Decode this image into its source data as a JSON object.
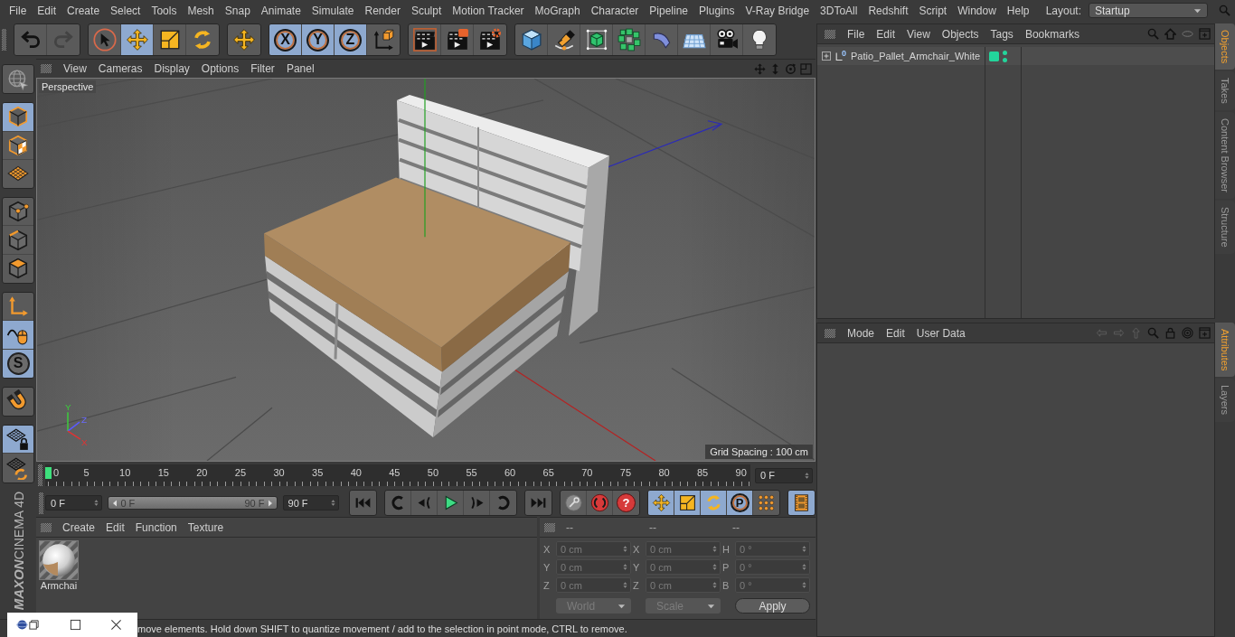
{
  "menu_bar": {
    "items": [
      "File",
      "Edit",
      "Create",
      "Select",
      "Tools",
      "Mesh",
      "Snap",
      "Animate",
      "Simulate",
      "Render",
      "Sculpt",
      "Motion Tracker",
      "MoGraph",
      "Character",
      "Pipeline",
      "Plugins",
      "V-Ray Bridge",
      "3DToAll",
      "Redshift",
      "Script",
      "Window",
      "Help"
    ],
    "layout_label": "Layout:",
    "layout_value": "Startup"
  },
  "toolbar": {
    "groups": [
      {
        "buttons": [
          {
            "kind": "undo",
            "selected": false,
            "disabled": false
          },
          {
            "kind": "redo",
            "selected": false,
            "disabled": true
          }
        ]
      },
      {
        "buttons": [
          {
            "kind": "select",
            "selected": false
          },
          {
            "kind": "move",
            "selected": true
          },
          {
            "kind": "scale",
            "selected": false
          },
          {
            "kind": "rotate",
            "selected": false
          }
        ]
      },
      {
        "buttons": [
          {
            "kind": "move",
            "selected": false
          }
        ]
      },
      {
        "buttons": [
          {
            "kind": "letter",
            "label": "X",
            "selected": true
          },
          {
            "kind": "letter",
            "label": "Y",
            "selected": true
          },
          {
            "kind": "letter",
            "label": "Z",
            "selected": true
          },
          {
            "kind": "coord-system",
            "selected": false
          }
        ]
      },
      {
        "buttons": [
          {
            "kind": "render-view",
            "selected": false
          },
          {
            "kind": "render-picture",
            "selected": false
          },
          {
            "kind": "render-settings",
            "selected": false
          }
        ]
      },
      {
        "buttons": [
          {
            "kind": "cube",
            "selected": false
          },
          {
            "kind": "pen",
            "selected": false
          },
          {
            "kind": "subdivision",
            "selected": false
          },
          {
            "kind": "cloner",
            "selected": false
          },
          {
            "kind": "deformer",
            "selected": false
          },
          {
            "kind": "floor",
            "selected": false
          },
          {
            "kind": "camera",
            "selected": false
          },
          {
            "kind": "light",
            "selected": false
          }
        ]
      }
    ]
  },
  "left_toolbar": {
    "groups": [
      {
        "buttons": [
          {
            "kind": "globe",
            "selected": false
          }
        ]
      },
      {
        "buttons": [
          {
            "kind": "model",
            "selected": true
          },
          {
            "kind": "texture",
            "selected": false
          },
          {
            "kind": "workplane",
            "selected": false
          }
        ]
      },
      {
        "buttons": [
          {
            "kind": "points",
            "selected": false
          },
          {
            "kind": "edges",
            "selected": false
          },
          {
            "kind": "polygons",
            "selected": false
          }
        ]
      },
      {
        "buttons": [
          {
            "kind": "axis",
            "selected": false
          },
          {
            "kind": "tweak",
            "selected": true
          },
          {
            "kind": "solo",
            "label": "S",
            "selected": true
          }
        ]
      },
      {
        "buttons": [
          {
            "kind": "magnet",
            "selected": false
          }
        ]
      },
      {
        "buttons": [
          {
            "kind": "grid-lock",
            "selected": true
          },
          {
            "kind": "grid-rotate",
            "selected": false
          }
        ]
      }
    ],
    "logo": {
      "brand": "MAXON",
      "product": "CINEMA 4D"
    }
  },
  "viewport": {
    "menu": [
      "View",
      "Cameras",
      "Display",
      "Options",
      "Filter",
      "Panel"
    ],
    "camera": "Perspective",
    "grid_spacing": "Grid Spacing : 100 cm",
    "axis_labels": {
      "x": "X",
      "y": "Y",
      "z": "Z"
    }
  },
  "timeline": {
    "labels": [
      "0",
      "5",
      "10",
      "15",
      "20",
      "25",
      "30",
      "35",
      "40",
      "45",
      "50",
      "55",
      "60",
      "65",
      "70",
      "75",
      "80",
      "85",
      "90"
    ],
    "playhead": {
      "level": 0
    },
    "current_frame": "0 F"
  },
  "transport": {
    "start_field": "0 F",
    "range": {
      "start": "0 F",
      "end": "90 F",
      "level": 1
    },
    "end_field": "90 F",
    "groups": [
      {
        "buttons": [
          {
            "kind": "to-start",
            "selected": false
          }
        ]
      },
      {
        "buttons": [
          {
            "kind": "prev-key",
            "selected": false
          },
          {
            "kind": "prev-frame",
            "selected": false
          },
          {
            "kind": "play",
            "selected": false
          },
          {
            "kind": "next-frame",
            "selected": false
          },
          {
            "kind": "next-key",
            "selected": false
          }
        ]
      },
      {
        "buttons": [
          {
            "kind": "to-end",
            "selected": false
          }
        ]
      },
      {
        "buttons": [
          {
            "kind": "record",
            "selected": false
          },
          {
            "kind": "autokey",
            "selected": false
          },
          {
            "kind": "help",
            "label": "?",
            "selected": false
          }
        ]
      },
      {
        "buttons": [
          {
            "kind": "move",
            "selected": true
          },
          {
            "kind": "scale",
            "selected": true
          },
          {
            "kind": "rotate",
            "selected": true
          },
          {
            "kind": "param",
            "label": "P",
            "selected": true
          },
          {
            "kind": "point-grid",
            "selected": false
          }
        ]
      },
      {
        "buttons": [
          {
            "kind": "film",
            "selected": true
          }
        ]
      }
    ]
  },
  "material_manager": {
    "menu": [
      "Create",
      "Edit",
      "Function",
      "Texture"
    ],
    "materials": [
      {
        "name": "Armchai"
      }
    ]
  },
  "coordinates": {
    "disabled": true,
    "headers": [
      "--",
      "--",
      "--"
    ],
    "rows": [
      {
        "position_axis": "X",
        "position": "0 cm",
        "size_axis": "X",
        "size": "0 cm",
        "rotation_axis": "H",
        "rotation": "0 °"
      },
      {
        "position_axis": "Y",
        "position": "0 cm",
        "size_axis": "Y",
        "size": "0 cm",
        "rotation_axis": "P",
        "rotation": "0 °"
      },
      {
        "position_axis": "Z",
        "position": "0 cm",
        "size_axis": "Z",
        "size": "0 cm",
        "rotation_axis": "B",
        "rotation": "0 °"
      }
    ],
    "space": "World",
    "mode": "Scale",
    "apply": "Apply"
  },
  "status_bar": {
    "text": "move elements. Hold down SHIFT to quantize movement / add to the selection in point mode, CTRL to remove."
  },
  "object_manager": {
    "menu": [
      "File",
      "Edit",
      "View",
      "Objects",
      "Tags",
      "Bookmarks"
    ],
    "objects": [
      {
        "name": "Patio_Pallet_Armchair_White",
        "icon_text": "0",
        "expanded": false
      }
    ]
  },
  "attribute_manager": {
    "menu": [
      "Mode",
      "Edit",
      "User Data"
    ]
  },
  "side_tabs": {
    "upper": [
      {
        "label": "Objects",
        "selected": true
      },
      {
        "label": "Takes",
        "selected": false
      },
      {
        "label": "Content Browser",
        "selected": false
      },
      {
        "label": "Structure",
        "selected": false
      }
    ],
    "lower": [
      {
        "label": "Attributes",
        "selected": true
      },
      {
        "label": "Layers",
        "selected": false
      }
    ]
  }
}
